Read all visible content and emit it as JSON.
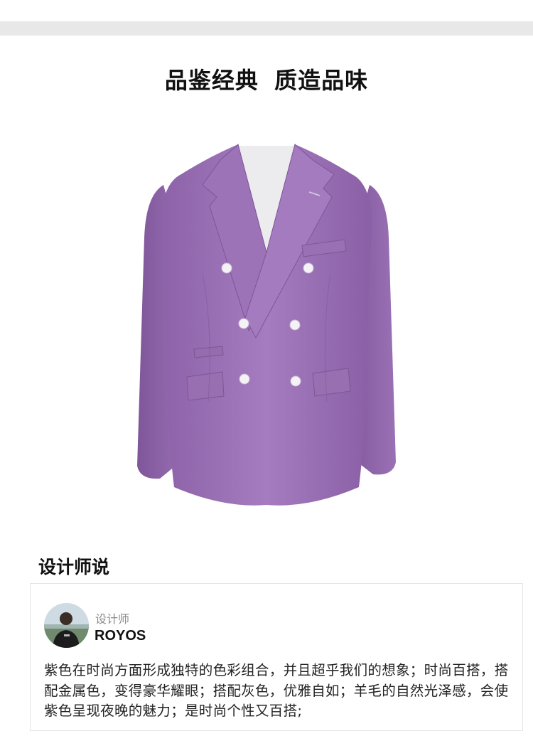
{
  "hero": {
    "title": "品鉴经典  质造品味"
  },
  "product": {
    "image_icon": "purple-double-breasted-suit-jacket",
    "color": "#9b6fb5"
  },
  "designer_section": {
    "title": "设计师说",
    "role": "设计师",
    "name": "ROYOS",
    "avatar_icon": "designer-avatar-photo",
    "quote": "紫色在时尚方面形成独特的色彩组合，并且超乎我们的想象；时尚百搭，搭配金属色，变得豪华耀眼；搭配灰色，优雅自如；羊毛的自然光泽感，会使紫色呈现夜晚的魅力；是时尚个性又百搭;"
  }
}
